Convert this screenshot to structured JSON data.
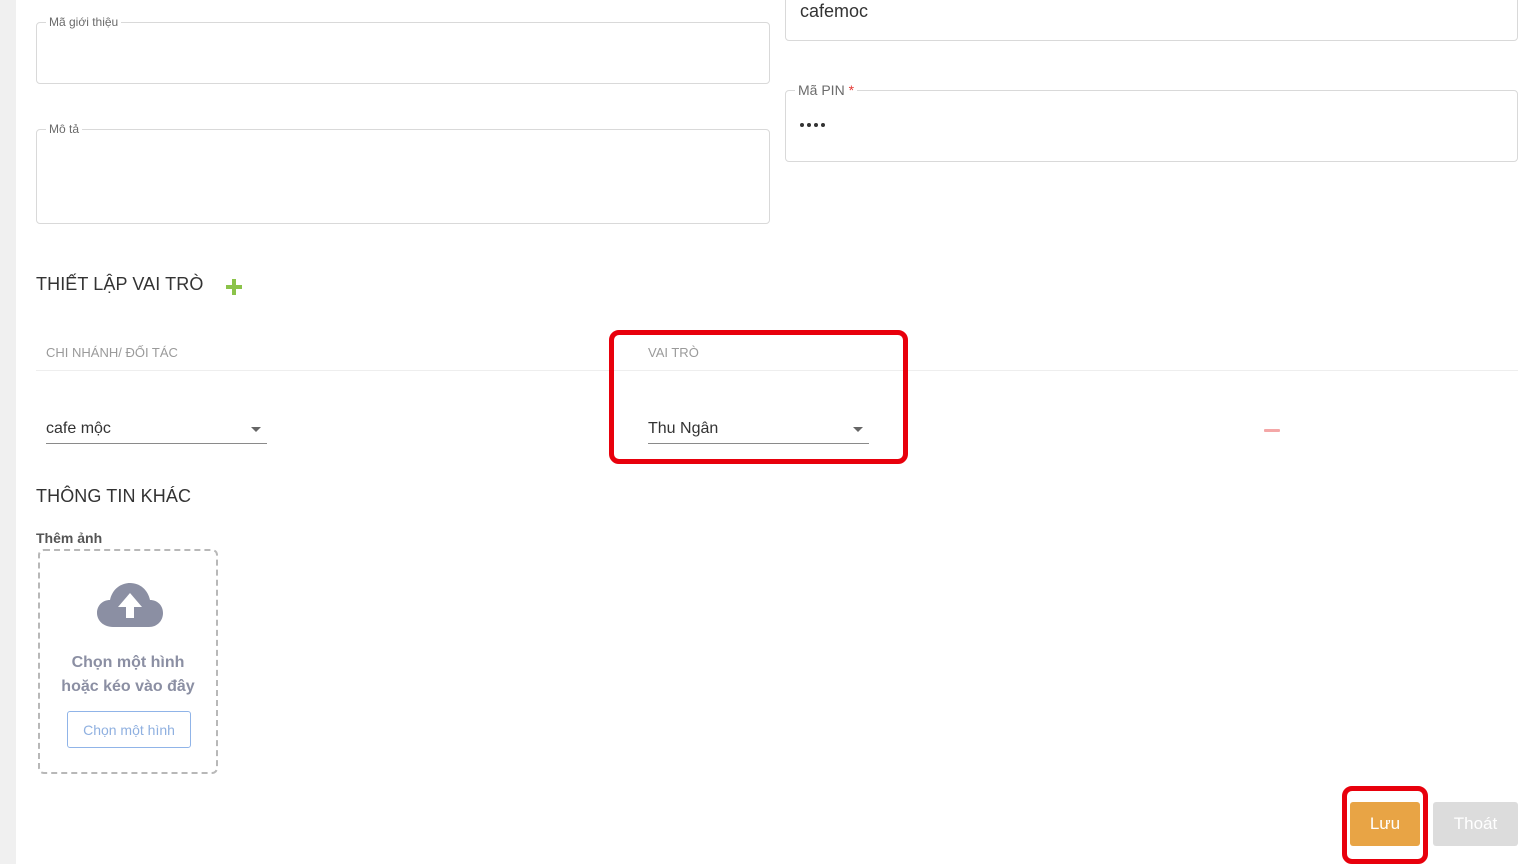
{
  "form": {
    "referral_code": {
      "label": "Mã giới thiệu",
      "value": ""
    },
    "description": {
      "label": "Mô tả",
      "value": ""
    },
    "username": {
      "value": "cafemoc"
    },
    "pin": {
      "label": "Mã PIN",
      "required_mark": "*",
      "masked_length": 4
    }
  },
  "roles_section": {
    "title": "THIẾT LẬP VAI TRÒ",
    "columns": [
      "CHI NHÁNH/ ĐỐI TÁC",
      "VAI TRÒ"
    ],
    "rows": [
      {
        "branch": "cafe mộc",
        "role": "Thu Ngân"
      }
    ]
  },
  "other_section": {
    "title": "THÔNG TIN KHÁC",
    "image_label": "Thêm ảnh",
    "upload_hint_line1": "Chọn một hình",
    "upload_hint_line2": "hoặc kéo vào đây",
    "upload_button": "Chọn một hình"
  },
  "actions": {
    "save": "Lưu",
    "exit": "Thoát"
  },
  "colors": {
    "accent_save": "#e8a445",
    "highlight": "#e8000c",
    "add_icon": "#8bc34a",
    "remove_icon": "#f4a7a7"
  },
  "icons": {
    "add": "plus-icon",
    "remove": "minus-icon",
    "upload": "cloud-upload-icon",
    "dropdown": "chevron-down-icon"
  }
}
